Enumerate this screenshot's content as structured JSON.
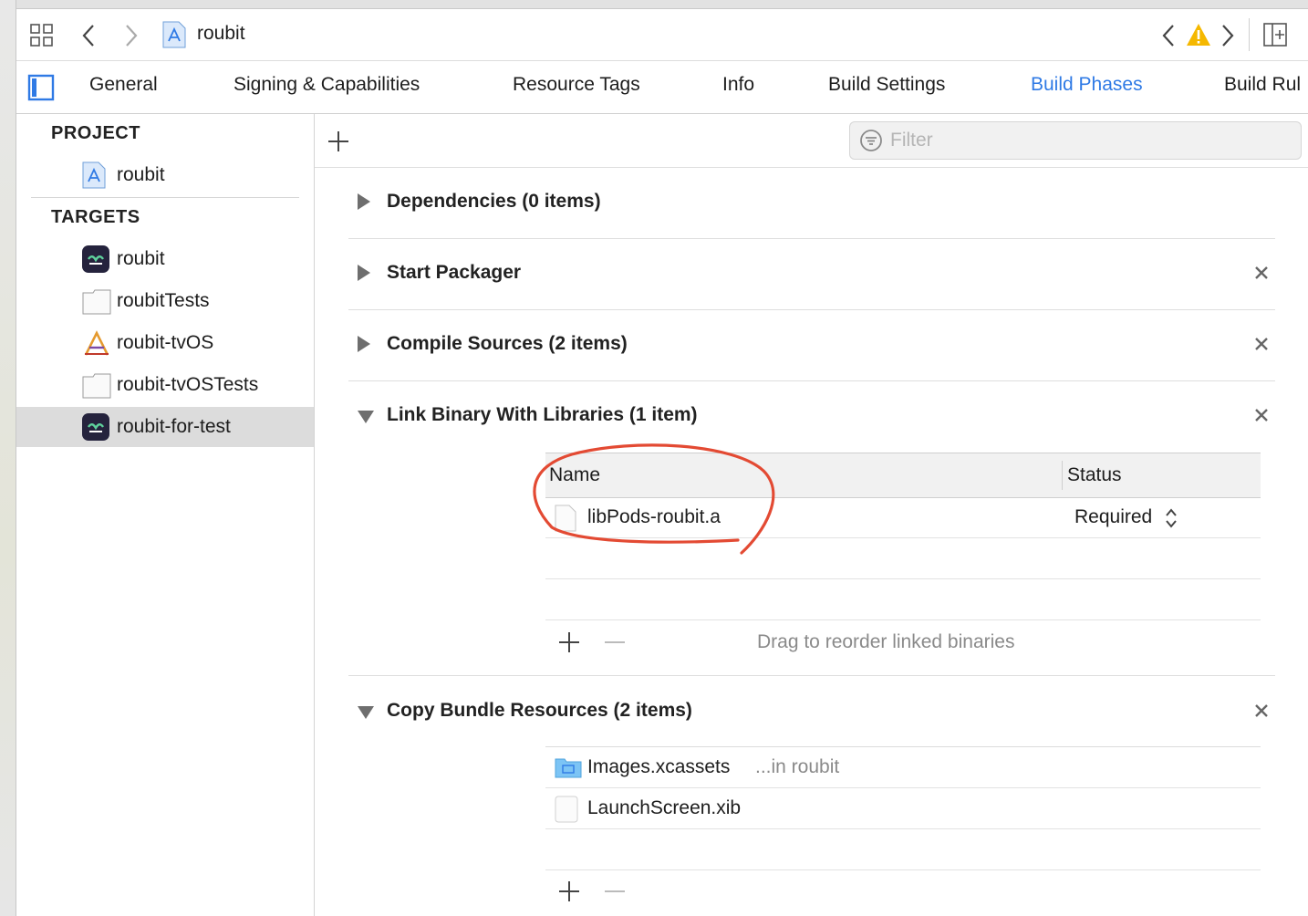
{
  "toolbar": {
    "breadcrumb_project": "roubit"
  },
  "tabs": [
    {
      "label": "General"
    },
    {
      "label": "Signing & Capabilities"
    },
    {
      "label": "Resource Tags"
    },
    {
      "label": "Info"
    },
    {
      "label": "Build Settings"
    },
    {
      "label": "Build Phases",
      "active": true
    },
    {
      "label": "Build Rul"
    }
  ],
  "sidebar": {
    "project_header": "PROJECT",
    "project_item": "roubit",
    "targets_header": "TARGETS",
    "targets": [
      {
        "label": "roubit",
        "icon": "app-icon"
      },
      {
        "label": "roubitTests",
        "icon": "test-bundle-icon"
      },
      {
        "label": "roubit-tvOS",
        "icon": "tvos-app-icon"
      },
      {
        "label": "roubit-tvOSTests",
        "icon": "test-bundle-icon"
      },
      {
        "label": "roubit-for-test",
        "icon": "app-icon",
        "selected": true
      }
    ]
  },
  "filter": {
    "placeholder": "Filter"
  },
  "phases": {
    "dependencies": "Dependencies (0 items)",
    "start_packager": "Start Packager",
    "compile_sources": "Compile Sources (2 items)",
    "link_binary": "Link Binary With Libraries (1 item)",
    "copy_bundle": "Copy Bundle Resources (2 items)"
  },
  "link_table": {
    "col_name": "Name",
    "col_status": "Status",
    "rows": [
      {
        "name": "libPods-roubit.a",
        "status": "Required"
      }
    ],
    "footer_hint": "Drag to reorder linked binaries"
  },
  "copy_table": {
    "rows": [
      {
        "name": "Images.xcassets",
        "location": "...in roubit"
      },
      {
        "name": "LaunchScreen.xib",
        "location": ""
      }
    ]
  },
  "colors": {
    "accent": "#2f7ae5",
    "annotation": "#e34a33",
    "warning": "#f5b800"
  }
}
